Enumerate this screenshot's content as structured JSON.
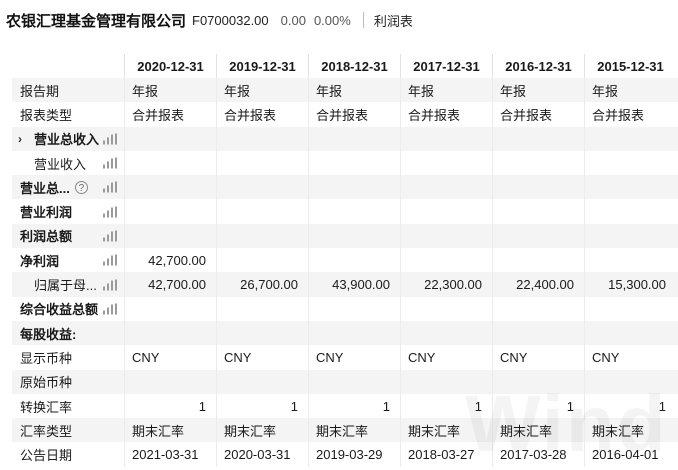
{
  "header": {
    "company": "农银汇理基金管理有限公司",
    "code": "F0700032.00",
    "price": "0.00",
    "change_pct": "0.00%",
    "statement": "利润表"
  },
  "periods": [
    "2020-12-31",
    "2019-12-31",
    "2018-12-31",
    "2017-12-31",
    "2016-12-31",
    "2015-12-31"
  ],
  "rows": [
    {
      "label": "报告期",
      "bold": false,
      "indent": false,
      "caret": false,
      "bars": false,
      "help": false,
      "numeric": false,
      "values": [
        "年报",
        "年报",
        "年报",
        "年报",
        "年报",
        "年报"
      ]
    },
    {
      "label": "报表类型",
      "bold": false,
      "indent": false,
      "caret": false,
      "bars": false,
      "help": false,
      "numeric": false,
      "values": [
        "合并报表",
        "合并报表",
        "合并报表",
        "合并报表",
        "合并报表",
        "合并报表"
      ]
    },
    {
      "label": "营业总收入",
      "bold": true,
      "indent": true,
      "caret": true,
      "bars": true,
      "help": false,
      "numeric": true,
      "values": [
        "",
        "",
        "",
        "",
        "",
        ""
      ]
    },
    {
      "label": "营业收入",
      "bold": false,
      "indent": true,
      "caret": false,
      "bars": true,
      "help": false,
      "numeric": true,
      "values": [
        "",
        "",
        "",
        "",
        "",
        ""
      ]
    },
    {
      "label": "营业总...",
      "bold": true,
      "indent": false,
      "caret": false,
      "bars": true,
      "help": true,
      "numeric": true,
      "values": [
        "",
        "",
        "",
        "",
        "",
        ""
      ]
    },
    {
      "label": "营业利润",
      "bold": true,
      "indent": false,
      "caret": false,
      "bars": true,
      "help": false,
      "numeric": true,
      "values": [
        "",
        "",
        "",
        "",
        "",
        ""
      ]
    },
    {
      "label": "利润总额",
      "bold": true,
      "indent": false,
      "caret": false,
      "bars": true,
      "help": false,
      "numeric": true,
      "values": [
        "",
        "",
        "",
        "",
        "",
        ""
      ]
    },
    {
      "label": "净利润",
      "bold": true,
      "indent": false,
      "caret": false,
      "bars": true,
      "help": false,
      "numeric": true,
      "values": [
        "42,700.00",
        "",
        "",
        "",
        "",
        ""
      ]
    },
    {
      "label": "归属于母...",
      "bold": false,
      "indent": true,
      "caret": false,
      "bars": true,
      "help": false,
      "numeric": true,
      "values": [
        "42,700.00",
        "26,700.00",
        "43,900.00",
        "22,300.00",
        "22,400.00",
        "15,300.00"
      ]
    },
    {
      "label": "综合收益总额",
      "bold": true,
      "indent": false,
      "caret": false,
      "bars": true,
      "help": false,
      "numeric": true,
      "values": [
        "",
        "",
        "",
        "",
        "",
        ""
      ]
    },
    {
      "label": "每股收益:",
      "bold": true,
      "indent": false,
      "caret": false,
      "bars": false,
      "help": false,
      "numeric": false,
      "values": [
        "",
        "",
        "",
        "",
        "",
        ""
      ]
    },
    {
      "label": "显示币种",
      "bold": false,
      "indent": false,
      "caret": false,
      "bars": false,
      "help": false,
      "numeric": false,
      "values": [
        "CNY",
        "CNY",
        "CNY",
        "CNY",
        "CNY",
        "CNY"
      ]
    },
    {
      "label": "原始币种",
      "bold": false,
      "indent": false,
      "caret": false,
      "bars": false,
      "help": false,
      "numeric": false,
      "values": [
        "",
        "",
        "",
        "",
        "",
        ""
      ]
    },
    {
      "label": "转换汇率",
      "bold": false,
      "indent": false,
      "caret": false,
      "bars": false,
      "help": false,
      "numeric": true,
      "values": [
        "1",
        "1",
        "1",
        "1",
        "1",
        "1"
      ]
    },
    {
      "label": "汇率类型",
      "bold": false,
      "indent": false,
      "caret": false,
      "bars": false,
      "help": false,
      "numeric": false,
      "values": [
        "期末汇率",
        "期末汇率",
        "期末汇率",
        "期末汇率",
        "期末汇率",
        "期末汇率"
      ]
    },
    {
      "label": "公告日期",
      "bold": false,
      "indent": false,
      "caret": false,
      "bars": false,
      "help": false,
      "numeric": false,
      "values": [
        "2021-03-31",
        "2020-03-31",
        "2019-03-29",
        "2018-03-27",
        "2017-03-28",
        "2016-04-01"
      ]
    }
  ],
  "icons": {
    "bars": "bar-chart-icon",
    "caret": "chevron-right-icon",
    "help": "question-circle-icon"
  },
  "help_glyph": "?",
  "caret_glyph": "›",
  "watermark": "Wind"
}
